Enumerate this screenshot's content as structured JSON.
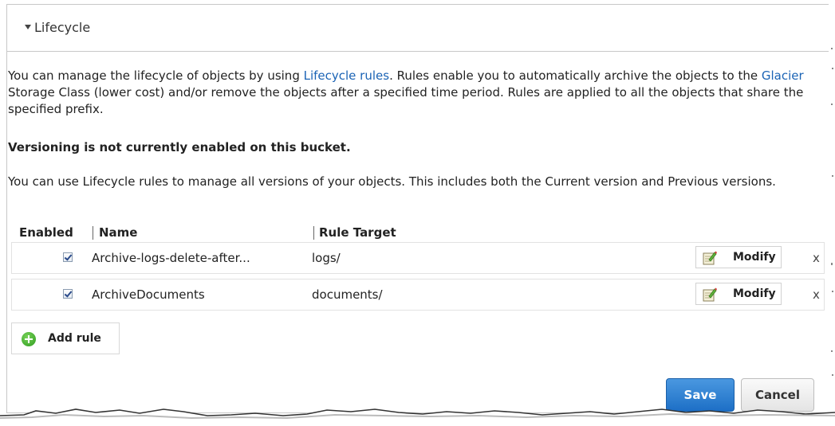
{
  "panel": {
    "title": "Lifecycle"
  },
  "intro": {
    "part1": "You can manage the lifecycle of objects by using ",
    "link1": "Lifecycle rules",
    "part2": ". Rules enable you to automatically archive the objects to the ",
    "link2": "Glacier",
    "part3": " Storage Class (lower cost) and/or remove the objects after a specified time period. Rules are applied to all the objects that share the specified prefix."
  },
  "versioning_notice": "Versioning is not currently enabled on this bucket.",
  "versions_text": "You can use Lifecycle rules to manage all versions of your objects. This includes both the Current version and Previous versions.",
  "table": {
    "headers": {
      "enabled": "Enabled",
      "name": "Name",
      "target": "Rule Target"
    },
    "rows": [
      {
        "enabled": true,
        "name": "Archive-logs-delete-after...",
        "target": "logs/",
        "modify_label": "Modify",
        "delete_label": "x"
      },
      {
        "enabled": true,
        "name": "ArchiveDocuments",
        "target": "documents/",
        "modify_label": "Modify",
        "delete_label": "x"
      }
    ]
  },
  "add_rule_label": "Add rule",
  "buttons": {
    "save": "Save",
    "cancel": "Cancel"
  },
  "colors": {
    "link": "#1a63b5",
    "primary_button": "#1d6fc6",
    "add_icon": "#2e9b1e"
  }
}
